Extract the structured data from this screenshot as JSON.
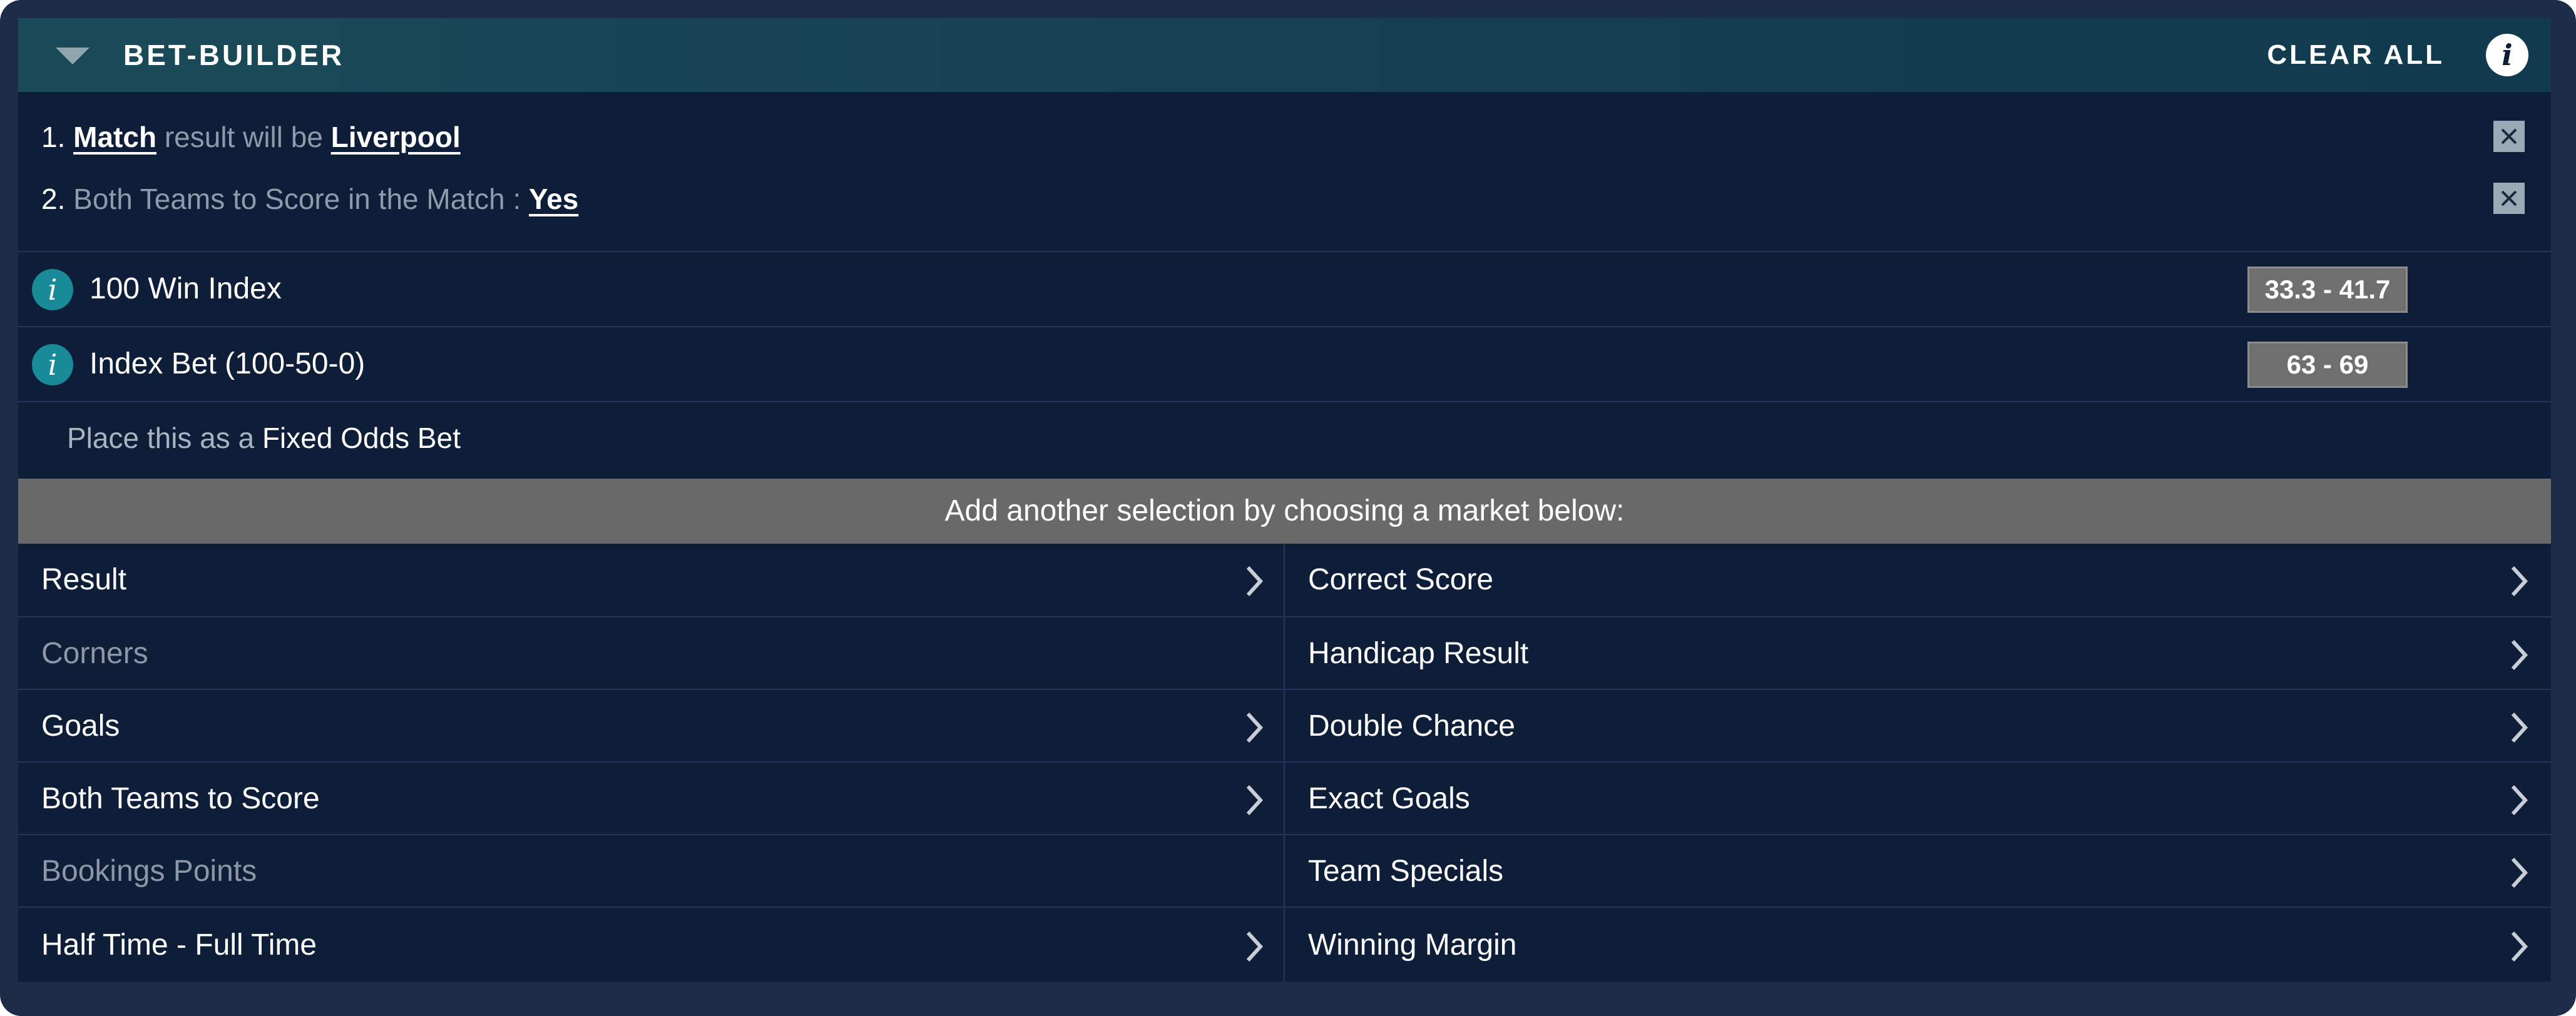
{
  "header": {
    "title": "BET-BUILDER",
    "clear_all": "CLEAR ALL",
    "info": "i"
  },
  "selections": [
    {
      "number": "1.",
      "part1_highlight": "Match",
      "part2": " result will be ",
      "part3_highlight": "Liverpool"
    },
    {
      "number": "2.",
      "part1": " Both Teams to Score in the Match : ",
      "part2_highlight": "Yes"
    }
  ],
  "index_bets": [
    {
      "label": "100 Win Index",
      "price": "33.3 - 41.7"
    },
    {
      "label": "Index Bet (100-50-0)",
      "price": "63 - 69"
    }
  ],
  "fixed_odds": {
    "prefix": "Place this as a ",
    "link": "Fixed Odds Bet"
  },
  "add_selection_text": "Add another selection by choosing a market below:",
  "markets": {
    "left": [
      {
        "label": "Result",
        "enabled": true
      },
      {
        "label": "Corners",
        "enabled": false
      },
      {
        "label": "Goals",
        "enabled": true
      },
      {
        "label": "Both Teams to Score",
        "enabled": true
      },
      {
        "label": "Bookings Points",
        "enabled": false
      },
      {
        "label": "Half Time - Full Time",
        "enabled": true
      }
    ],
    "right": [
      {
        "label": "Correct Score",
        "enabled": true
      },
      {
        "label": "Handicap Result",
        "enabled": true
      },
      {
        "label": "Double Chance",
        "enabled": true
      },
      {
        "label": "Exact Goals",
        "enabled": true
      },
      {
        "label": "Team Specials",
        "enabled": true
      },
      {
        "label": "Winning Margin",
        "enabled": true
      }
    ]
  },
  "colors": {
    "background": "#0f1e38",
    "header": "#1a4a58",
    "info_teal": "#198a98",
    "price_button": "#6f6f70",
    "add_bar": "#696969"
  },
  "icons": {
    "collapse": "triangle-down-icon",
    "info": "info-icon",
    "remove": "close-icon",
    "market_arrow": "chevron-right-icon"
  }
}
